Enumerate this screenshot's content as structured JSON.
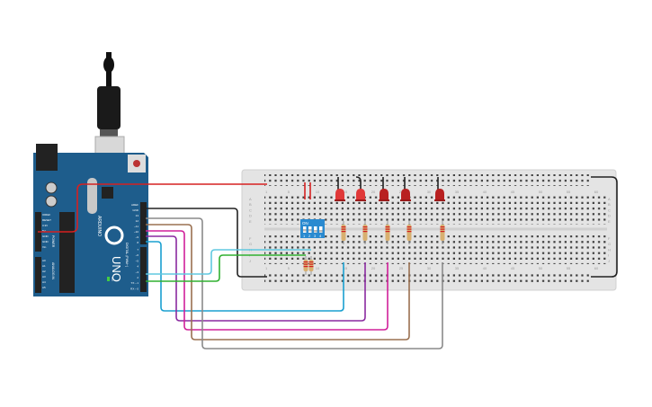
{
  "board": {
    "name": "ARDUINO",
    "model": "UNO",
    "power_label": "POWER",
    "analog_label": "ANALOG IN",
    "digital_label": "DIGITAL (PWM~)",
    "on_label": "ON",
    "tx_label": "TX",
    "rx_label": "RX",
    "power_pins": [
      "IOREF",
      "RESET",
      "3.3V",
      "5V",
      "GND",
      "GND",
      "Vin"
    ],
    "analog_pins": [
      "A0",
      "A1",
      "A2",
      "A3",
      "A4",
      "A5"
    ],
    "digital_pins_top": [
      "AREF",
      "GND",
      "13",
      "12",
      "~11",
      "~10",
      "~9",
      "8"
    ],
    "digital_pins_bottom": [
      "7",
      "~6",
      "~5",
      "4",
      "~3",
      "2",
      "TX→1",
      "RX←0"
    ]
  },
  "breadboard": {
    "row_letters_top": [
      "A",
      "B",
      "C",
      "D",
      "E"
    ],
    "row_letters_bottom": [
      "F",
      "G",
      "H",
      "I",
      "J"
    ],
    "column_numbers": [
      "1",
      "5",
      "10",
      "15",
      "20",
      "25",
      "30",
      "35",
      "40",
      "45",
      "50",
      "55",
      "60"
    ]
  },
  "dip_switch": {
    "on_label": "ON",
    "positions": [
      "1",
      "2",
      "3",
      "4"
    ]
  },
  "colors": {
    "board": "#1e5d8c",
    "breadboard": "#e4e4e4",
    "wire_power": "#d62020",
    "wire_ground": "#222222",
    "wire_pin8": "#1aa0d0",
    "wire_pin9": "#8a2aa0",
    "wire_pin10": "#d0209a",
    "wire_pin11": "#9a7050",
    "wire_pin12": "#8a8a8a",
    "wire_pin2": "#60c8e0",
    "wire_pin1": "#30b030",
    "led": "#c82828",
    "dip": "#2a8ad0"
  }
}
